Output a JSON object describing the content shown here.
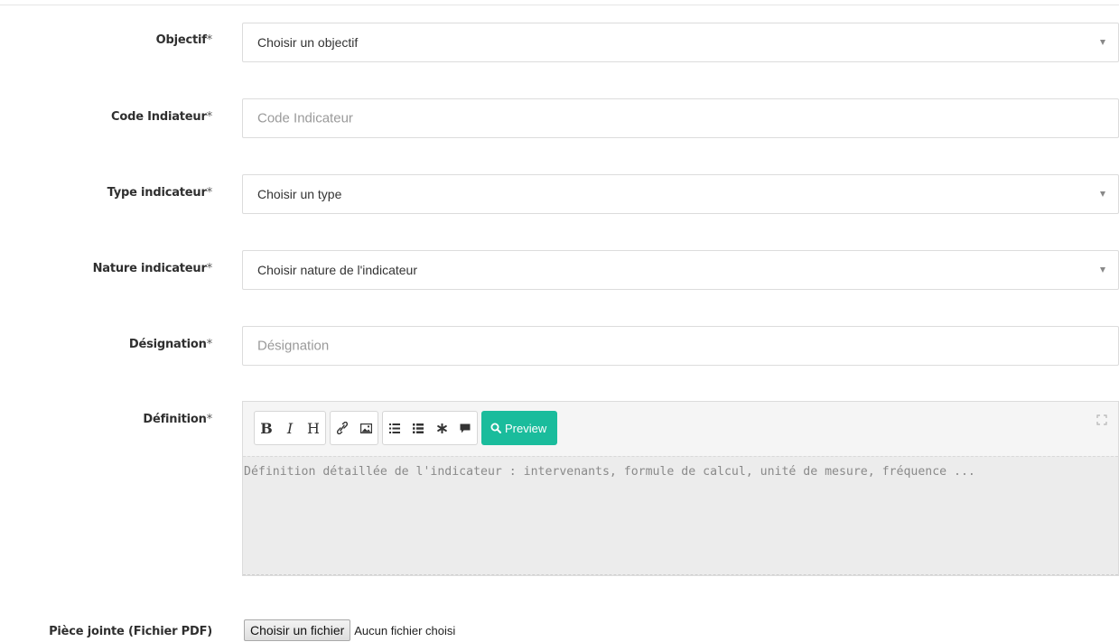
{
  "form": {
    "objectif": {
      "label": "Objectif",
      "required_mark": "*",
      "selected": "Choisir un objectif"
    },
    "code_indicateur": {
      "label": "Code Indiateur",
      "required_mark": "*",
      "placeholder": "Code Indicateur",
      "value": ""
    },
    "type_indicateur": {
      "label": "Type indicateur",
      "required_mark": "*",
      "selected": "Choisir un type"
    },
    "nature_indicateur": {
      "label": "Nature indicateur",
      "required_mark": "*",
      "selected": "Choisir nature de l'indicateur"
    },
    "designation": {
      "label": "Désignation",
      "required_mark": "*",
      "placeholder": "Désignation",
      "value": ""
    },
    "definition": {
      "label": "Définition",
      "required_mark": "*",
      "toolbar": {
        "bold": "B",
        "italic": "I",
        "heading": "H",
        "preview_label": "Preview"
      },
      "placeholder": "Définition détaillée de l'indicateur : intervenants, formule de calcul, unité de mesure, fréquence ..."
    },
    "piece_jointe": {
      "label": "Pièce jointe (Fichier PDF)",
      "button_label": "Choisir un fichier",
      "status": "Aucun fichier choisi"
    }
  },
  "icons": [
    "link-icon",
    "image-icon",
    "ordered-list-icon",
    "unordered-list-icon",
    "asterisk-icon",
    "comment-icon",
    "search-icon",
    "fullscreen-icon",
    "chevron-down-icon"
  ],
  "colors": {
    "preview_button": "#1abc9c",
    "editor_background": "#ececec"
  }
}
